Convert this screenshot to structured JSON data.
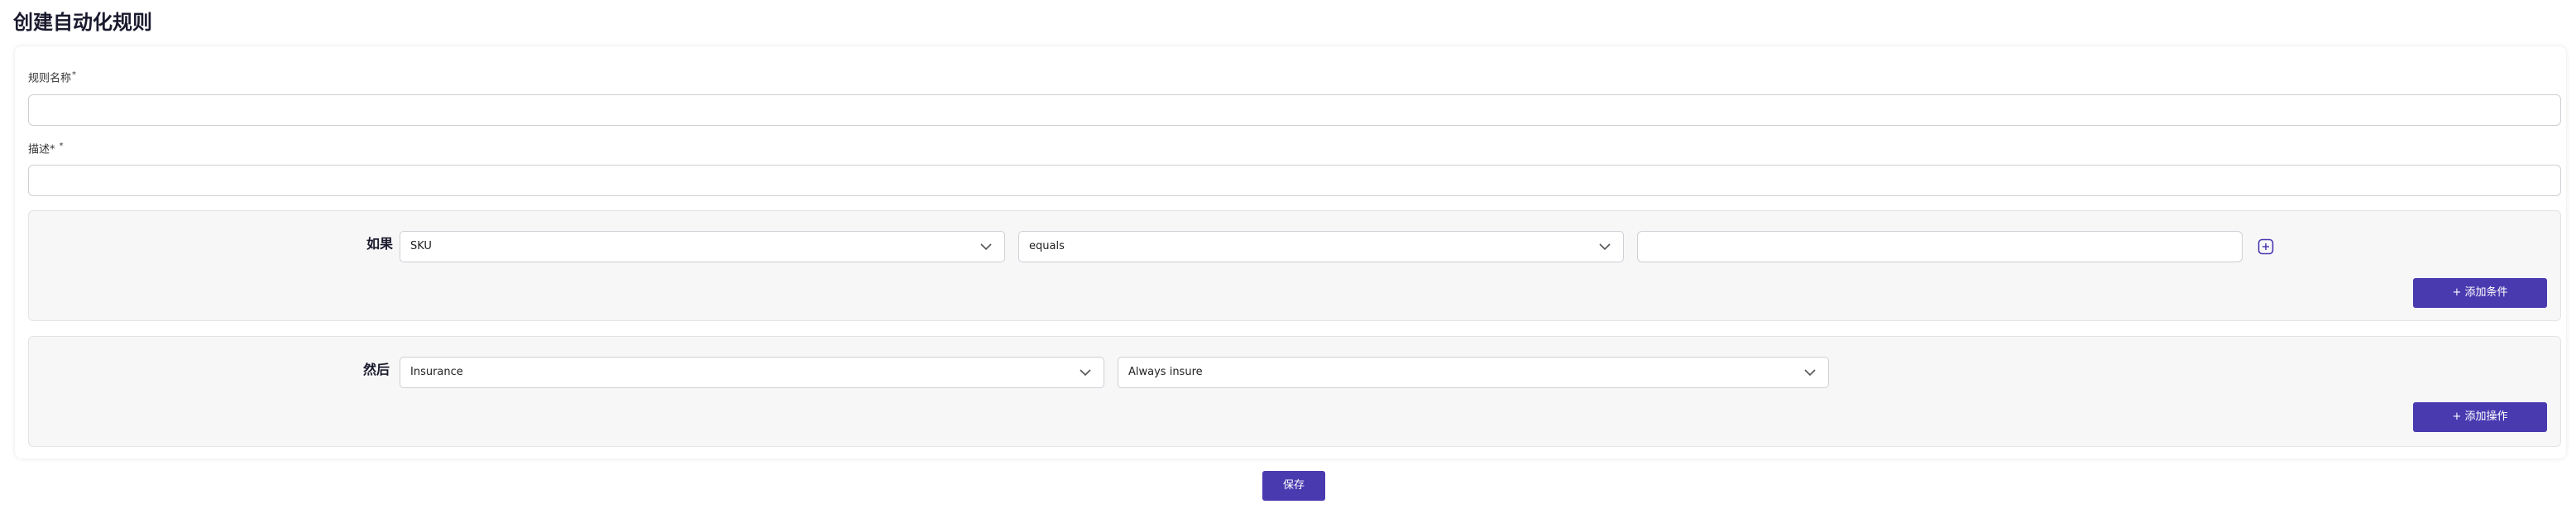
{
  "page": {
    "title": "创建自动化规则"
  },
  "form": {
    "name_label": "规则名称",
    "name_required": "*",
    "name_value": "",
    "description_label": "描述*",
    "description_required": "*",
    "description_value": ""
  },
  "conditions": {
    "label": "如果",
    "field_select": "SKU",
    "operator_select": "equals",
    "value_input": "",
    "add_button": "+ 添加条件"
  },
  "actions": {
    "label": "然后",
    "action_select": "Insurance",
    "option_select": "Always insure",
    "add_button": "+ 添加操作"
  },
  "footer": {
    "save_button": "保存"
  },
  "colors": {
    "primary": "#4a3ab0",
    "panel_bg": "#f7f7f8",
    "border": "#cfcfd6"
  },
  "icons": {
    "chevron": "chevron-down-icon",
    "add_condition": "plus-square-icon"
  }
}
